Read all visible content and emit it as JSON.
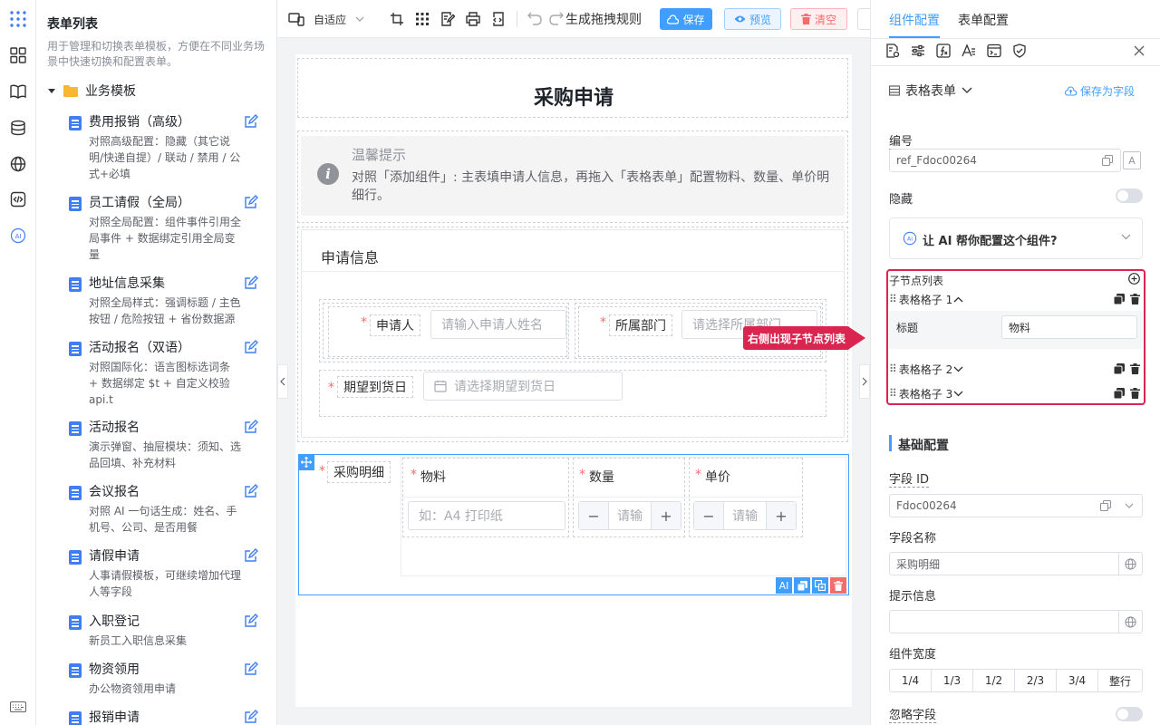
{
  "sidebar": {
    "title": "表单列表",
    "description": "用于管理和切换表单模板，方便在不同业务场景中快速切换和配置表单。",
    "folder_label": "业务模板",
    "templates": [
      {
        "name": "费用报销（高级）",
        "desc": "对照高级配置：隐藏（其它说明/快递自提）/ 联动 / 禁用 / 公式+必填"
      },
      {
        "name": "员工请假（全局）",
        "desc": "对照全局配置：组件事件引用全局事件 + 数据绑定引用全局变量"
      },
      {
        "name": "地址信息采集",
        "desc": "对照全局样式：强调标题 / 主色按钮 / 危险按钮 + 省份数据源"
      },
      {
        "name": "活动报名（双语）",
        "desc": "对照国际化：语言图标选词条 + 数据绑定 $t + 自定义校验 api.t"
      },
      {
        "name": "活动报名",
        "desc": "演示弹窗、抽屉模块：须知、选品回填、补充材料"
      },
      {
        "name": "会议报名",
        "desc": "对照 AI 一句话生成：姓名、手机号、公司、是否用餐"
      },
      {
        "name": "请假申请",
        "desc": "人事请假模板，可继续增加代理人等字段"
      },
      {
        "name": "入职登记",
        "desc": "新员工入职信息采集"
      },
      {
        "name": "物资领用",
        "desc": "办公物资领用申请"
      },
      {
        "name": "报销申请",
        "desc": ""
      }
    ]
  },
  "toolbar": {
    "adaptive_label": "自适应",
    "generate_drag_rules_label": "生成拖拽规则",
    "save_label": "保存",
    "preview_label": "预览",
    "clear_label": "清空"
  },
  "form": {
    "title": "采购申请",
    "notice_title": "温馨提示",
    "notice_text": "对照「添加组件」: 主表填申请人信息，再拖入「表格表单」配置物料、数量、单价明细行。",
    "section_title": "申请信息",
    "applicant_label": "申请人",
    "applicant_placeholder": "请输入申请人姓名",
    "dept_label": "所属部门",
    "dept_placeholder": "请选择所属部门",
    "date_label": "期望到货日",
    "date_placeholder": "请选择期望到货日",
    "detail_label": "采购明细",
    "col_material": "物料",
    "col_qty": "数量",
    "col_price": "单价",
    "material_placeholder": "如：A4 打印纸",
    "qty_placeholder": "请输",
    "price_placeholder": "请输",
    "minus": "−",
    "plus": "+",
    "ai_badge": "AI"
  },
  "panel": {
    "tab_component": "组件配置",
    "tab_form": "表单配置",
    "component_type": "表格表单",
    "save_as_field": "保存为字段",
    "id_label": "编号",
    "id_value": "ref_Fdoc00264",
    "hidden_label": "隐藏",
    "ai_help": "让 AI 帮你配置这个组件?",
    "children_title": "子节点列表",
    "children": [
      "表格格子 1",
      "表格格子 2",
      "表格格子 3"
    ],
    "child_title_label": "标题",
    "child_title_value": "物料",
    "callout": "右侧出现子节点列表",
    "basic_config": "基础配置",
    "field_id_label": "字段 ID",
    "field_id_value": "Fdoc00264",
    "field_name_label": "字段名称",
    "field_name_value": "采购明细",
    "hint_label": "提示信息",
    "hint_value": "",
    "width_label": "组件宽度",
    "widths": [
      "1/4",
      "1/3",
      "1/2",
      "2/3",
      "3/4",
      "整行"
    ],
    "ignore_label": "忽略字段"
  },
  "colors": {
    "primary": "#409eff",
    "accent_callout": "#d9254f",
    "danger": "#f56c6c"
  }
}
